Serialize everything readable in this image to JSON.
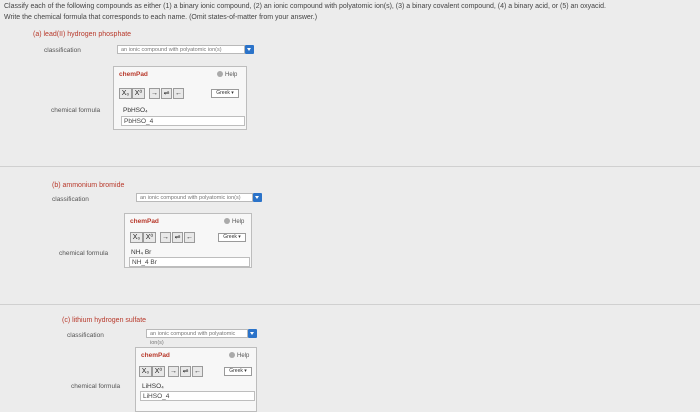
{
  "instructions": {
    "line1": "Classify each of the following compounds as either (1) a binary ionic compound, (2) an ionic compound with polyatomic ion(s), (3) a binary covalent compound, (4) a binary acid, or (5) an oxyacid.",
    "line2": "Write the chemical formula that corresponds to each name. (Omit states-of-matter from your answer.)"
  },
  "parts": [
    {
      "title": "(a) lead(II) hydrogen phosphate",
      "classification_label": "classification",
      "classification_value": "an ionic compound with polyatomic ion(s)",
      "formula_label": "chemical formula",
      "chempad": {
        "title": "chemPad",
        "help": "Help",
        "tools": [
          "X₀",
          "X⁰",
          "→",
          "⇌",
          "←"
        ],
        "greek": "Greek ▾"
      },
      "formula_preview": "PbHSO₄",
      "formula_raw": "PbHSO_4"
    },
    {
      "title": "(b) ammonium bromide",
      "classification_label": "classification",
      "classification_value": "an ionic compound with polyatomic ion(s)",
      "formula_label": "chemical formula",
      "chempad": {
        "title": "chemPad",
        "help": "Help",
        "tools": [
          "X₀",
          "X⁰",
          "→",
          "⇌",
          "←"
        ],
        "greek": "Greek ▾"
      },
      "formula_preview": "NH₄ Br",
      "formula_raw": "NH_4 Br"
    },
    {
      "title": "(c) lithium hydrogen sulfate",
      "classification_label": "classification",
      "classification_value": "an ionic compound with polyatomic ion(s)",
      "formula_label": "chemical formula",
      "chempad": {
        "title": "chemPad",
        "help": "Help",
        "tools": [
          "X₀",
          "X⁰",
          "→",
          "⇌",
          "←"
        ],
        "greek": "Greek ▾"
      },
      "formula_preview": "LiHSO₄",
      "formula_raw": "LiHSO_4"
    }
  ]
}
